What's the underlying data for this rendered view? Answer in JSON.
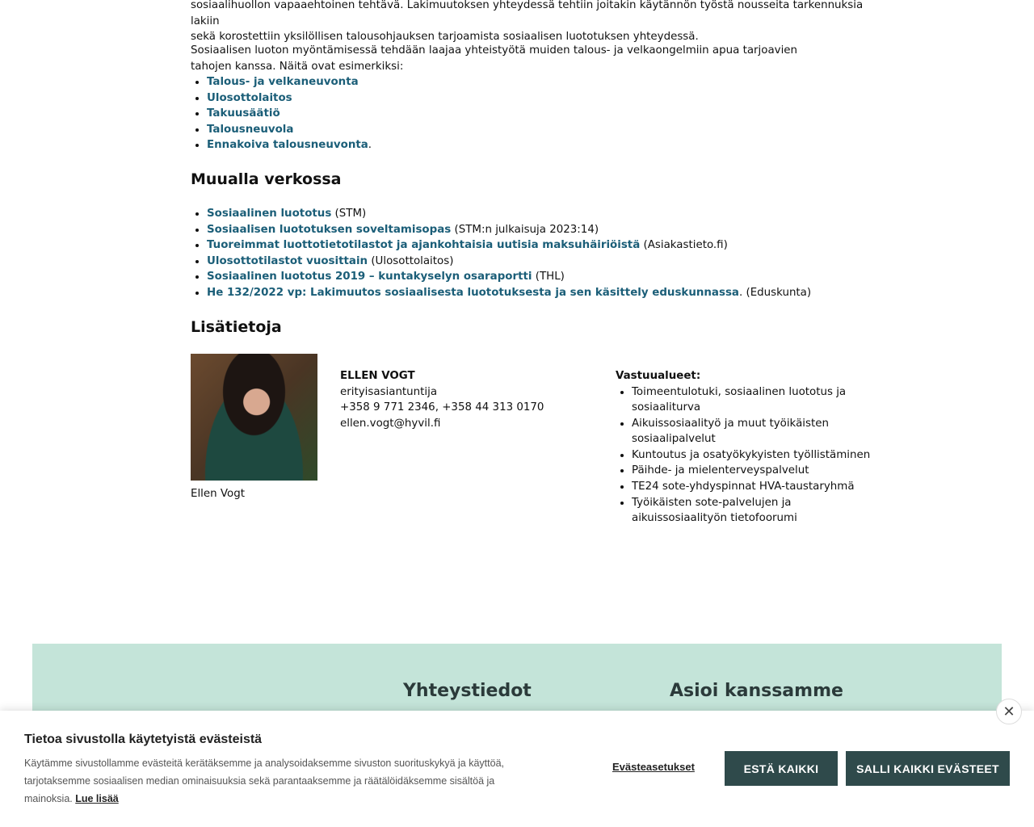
{
  "article": {
    "intro_line1": "sosiaalihuollon vapaaehtoinen tehtävä. Lakimuutoksen yhteydessä tehtiin joitakin käytännön työstä nousseita tarkennuksia lakiin",
    "intro_line2": "sekä korostettiin yksilöllisen talousohjauksen tarjoamista sosiaalisen luototuksen yhteydessä.",
    "coop_text": "Sosiaalisen luoton myöntämisessä tehdään laajaa yhteistyötä muiden talous- ja velkaongelmiin apua tarjoavien tahojen kanssa.  Näitä ovat esimerkiksi:",
    "coop_links": [
      {
        "label": "Talous- ja velkaneuvonta",
        "suffix": ""
      },
      {
        "label": "Ulosottolaitos",
        "suffix": ""
      },
      {
        "label": "Takuusäätiö",
        "suffix": ""
      },
      {
        "label": "Talousneuvola",
        "suffix": ""
      },
      {
        "label": "Ennakoiva talousneuvonta",
        "suffix": "."
      }
    ],
    "elsewhere_heading": "Muualla verkossa",
    "elsewhere_links": [
      {
        "label": "Sosiaalinen luototus",
        "suffix": " (STM)"
      },
      {
        "label": "Sosiaalisen luototuksen soveltamisopas",
        "suffix": " (STM:n julkaisuja 2023:14)"
      },
      {
        "label": "Tuoreimmat luottotietotilastot ja ajankohtaisia uutisia maksuhäiriöistä",
        "suffix": " (Asiakastieto.fi)"
      },
      {
        "label": "Ulosottotilastot vuosittain",
        "suffix": " (Ulosottolaitos)"
      },
      {
        "label": "Sosiaalinen luototus 2019 – kuntakyselyn osaraportti",
        "suffix": " (THL)"
      },
      {
        "label": "He 132/2022 vp: Lakimuutos sosiaalisesta luototuksesta ja sen käsittely eduskunnassa",
        "suffix": ". (Eduskunta)"
      }
    ],
    "info_heading": "Lisätietoja"
  },
  "contact": {
    "photo_caption": "Ellen Vogt",
    "name": "ELLEN VOGT",
    "title": "erityisasiantuntija",
    "phone": "+358 9 771 2346, +358 44 313 0170",
    "email": "ellen.vogt@hyvil.fi",
    "responsibilities_heading": "Vastuualueet:",
    "responsibilities": [
      "Toimeentulotuki, sosiaalinen luototus ja sosiaaliturva",
      "Aikuissosiaalityö ja muut työikäisten sosiaalipalvelut",
      "Kuntoutus ja osatyökykyisten työllistäminen",
      "Päihde- ja mielenterveyspalvelut",
      "TE24 sote-yhdyspinnat HVA-taustaryhmä",
      "Työikäisten sote-palvelujen ja aikuissosiaalityön tietofoorumi"
    ]
  },
  "footer": {
    "contact_heading": "Yhteystiedot",
    "services_heading": "Asioi kanssamme"
  },
  "cookie_banner": {
    "title": "Tietoa sivustolla käytetyistä evästeistä",
    "text": "Käytämme sivustollamme evästeitä kerätäksemme ja analysoidaksemme sivuston suorituskykyä ja käyttöä, tarjotaksemme sosiaalisen median ominaisuuksia sekä parantaaksemme ja räätälöidäksemme sisältöä ja mainoksia.",
    "read_more": "Lue lisää",
    "settings_label": "Evästeasetukset",
    "reject_label": "ESTÄ KAIKKI",
    "accept_label": "SALLI KAIKKI EVÄSTEET",
    "close_symbol": "✕"
  },
  "colors": {
    "link": "#1b5e78",
    "footer_bg": "#c4e4d9",
    "button_bg": "#2f4a4b"
  }
}
